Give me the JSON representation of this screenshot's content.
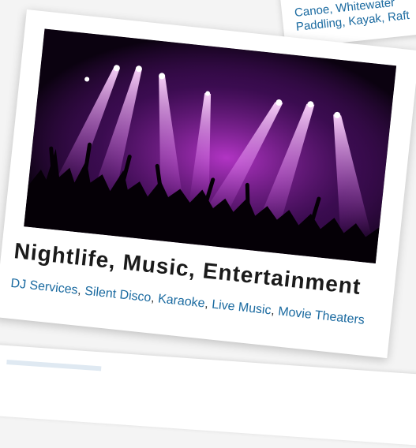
{
  "background_card": {
    "links": [
      "Canoe, Whitewater",
      "Paddling, Kayak, Raft"
    ]
  },
  "main_card": {
    "title": "Nightlife, Music, Entertainment",
    "links": [
      "DJ Services",
      "Silent Disco",
      "Karaoke",
      "Live Music",
      "Movie Theaters"
    ],
    "link_color": "#1a6aa0",
    "photo_icon": "concert-photo"
  }
}
